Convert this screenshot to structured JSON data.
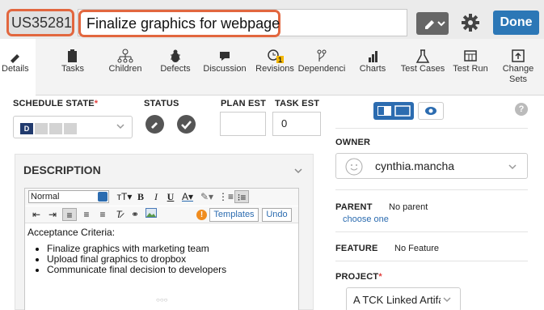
{
  "header": {
    "formatted_id": "US35281",
    "title": "Finalize graphics for webpage",
    "done_label": "Done"
  },
  "tabs": [
    {
      "id": "details",
      "label": "Details",
      "icon": "pencil-icon",
      "active": true
    },
    {
      "id": "tasks",
      "label": "Tasks",
      "icon": "clipboard-icon"
    },
    {
      "id": "children",
      "label": "Children",
      "icon": "hierarchy-icon"
    },
    {
      "id": "defects",
      "label": "Defects",
      "icon": "bug-icon"
    },
    {
      "id": "discussion",
      "label": "Discussion",
      "icon": "speech-bubble-icon"
    },
    {
      "id": "revisions",
      "label": "Revisions",
      "icon": "history-icon",
      "badge": "1"
    },
    {
      "id": "dependencies",
      "label": "Dependenci",
      "icon": "branch-icon"
    },
    {
      "id": "charts",
      "label": "Charts",
      "icon": "bar-chart-icon"
    },
    {
      "id": "test-cases",
      "label": "Test Cases",
      "icon": "flask-icon"
    },
    {
      "id": "test-run",
      "label": "Test Run",
      "icon": "table-icon"
    },
    {
      "id": "change-sets",
      "label": "Change\nSets",
      "icon": "changeset-icon"
    }
  ],
  "fields": {
    "schedule_state_label": "SCHEDULE STATE",
    "schedule_state_value": "D",
    "status_label": "STATUS",
    "plan_est_label": "PLAN EST",
    "plan_est_value": "",
    "task_est_label": "TASK EST",
    "task_est_value": "0"
  },
  "description": {
    "label": "DESCRIPTION",
    "format": "Normal",
    "templates_label": "Templates",
    "undo_label": "Undo",
    "heading": "Acceptance Criteria:",
    "items": [
      "Finalize graphics with marketing team",
      "Upload final graphics to dropbox",
      "Communicate final decision to developers"
    ]
  },
  "right": {
    "owner_label": "OWNER",
    "owner_value": "cynthia.mancha",
    "parent_label": "PARENT",
    "parent_value": "No parent",
    "parent_link": "choose one",
    "feature_label": "FEATURE",
    "feature_value": "No Feature",
    "project_label": "PROJECT",
    "project_value": "A TCK Linked Artifact"
  },
  "colors": {
    "accent": "#2c77b6",
    "highlight": "#e2673f",
    "required": "#e2413f",
    "badge": "#f5b800"
  }
}
